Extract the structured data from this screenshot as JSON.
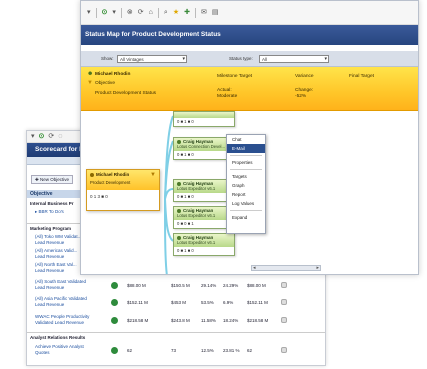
{
  "back": {
    "toolbar_glyphs": [
      "▾",
      "⟳",
      "◌"
    ],
    "title": "Scorecard for M",
    "new_objective": "New Objective",
    "objective_header": "Objective",
    "section_internal": "Internal Business Pr",
    "link_bbr": "BBR To Do's",
    "section_marketing": "Marketing Program",
    "rows": [
      {
        "label": "(All) Toko WM Validat...",
        "sub": "Lead Revenue",
        "values": []
      },
      {
        "label": "(All) Americas Valid...",
        "sub": "Lead Revenue",
        "values": []
      },
      {
        "label": "(All) North East Val...",
        "sub": "Lead Revenue",
        "values": []
      },
      {
        "label": "(All) South East Validated",
        "sub": "Lead Revenue",
        "values": [
          "$88.00 M",
          "$150.5 M",
          "29.14%",
          "24.29%",
          "$88.00 M"
        ]
      },
      {
        "label": "(All) Asia Pacific Validated",
        "sub": "Lead Revenue",
        "values": [
          "$152.11 M",
          "$453 M",
          "53.5%",
          "6.9%",
          "$152.11 M"
        ]
      },
      {
        "label": "WWAC People Productivity",
        "sub": "Validated Lead Revenue",
        "values": [
          "$218.58 M",
          "$243.8 M",
          "11.58%",
          "18.24%",
          "$218.58 M"
        ]
      }
    ],
    "section_analyst": "Analyst Relations Results",
    "analyst_row": {
      "label": "Achieve Positive Analyst",
      "sub": "Quotes",
      "values": [
        "62",
        "73",
        "12.5%",
        "23.81 %",
        "62"
      ]
    }
  },
  "front": {
    "title": "Status Map for Product Development Status",
    "filters": {
      "show_label": "Show:",
      "show_value": "All Vintages",
      "status_label": "Status type:",
      "status_value": "All"
    },
    "header": {
      "owner": "Michael Rhodin",
      "type": "Objective",
      "name": "Product Development Status",
      "col_milestone": "Milestone Target",
      "col_variance": "Variance",
      "col_final": "Final Target",
      "actual_label": "Actual:",
      "actual_value": "Moderate",
      "change_label": "Change:",
      "change_value": "-52%"
    },
    "root_node": {
      "owner": "Michael Rhodin",
      "title": "Product Development",
      "stats": "0 1 3 ■ 0"
    },
    "nodes": [
      {
        "owner": "",
        "title": "",
        "stats": "0 ■ 1 ■ 0",
        "tone": "green"
      },
      {
        "owner": "Craig Hayman",
        "title": "Lotus Connection Devel...",
        "stats": "0 ■ 1 ■ 0",
        "tone": "green"
      },
      {
        "owner": "Craig Hayman",
        "title": "Lotus Expeditor v6.1",
        "stats": "0 ■ 1 ■ 0",
        "tone": "green"
      },
      {
        "owner": "Craig Hayman",
        "title": "Lotus Expeditor v6.1",
        "stats": "0 ■ 0 ■ 1",
        "tone": "green"
      },
      {
        "owner": "Craig Hayman",
        "title": "Lotus Expeditor v6.1",
        "stats": "0 ■ 1 ■ 0",
        "tone": "green"
      }
    ],
    "context_menu": [
      "Chat",
      "E-Mail",
      "Properties",
      "Targets",
      "Graph",
      "Report",
      "Log Values",
      "Expand"
    ]
  },
  "colors": {
    "title_bar": "#27467f",
    "yellow_band": "#ffc629",
    "node_green": "#b8d98a",
    "menu_selected": "#2a4f8f"
  }
}
